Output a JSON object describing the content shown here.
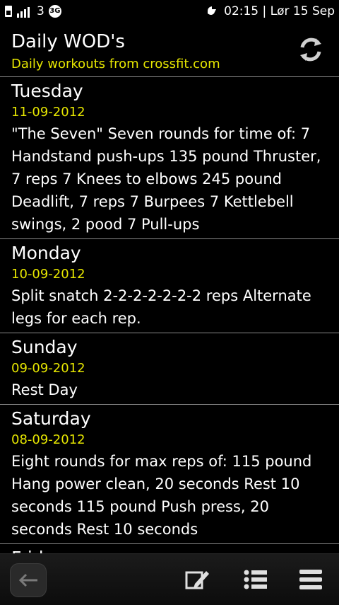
{
  "status": {
    "signal_label": "3",
    "network_badge": "3G",
    "time_date": "02:15 | Lør 15 Sep"
  },
  "header": {
    "title": "Daily WOD's",
    "subtitle": "Daily workouts from crossfit.com"
  },
  "entries": [
    {
      "day": "Tuesday",
      "date": "11-09-2012",
      "description": "\"The Seven\" Seven rounds for time of: 7 Handstand push-ups 135 pound Thruster, 7 reps 7 Knees to elbows 245 pound Deadlift, 7 reps 7 Burpees 7 Kettlebell swings, 2 pood 7 Pull-ups"
    },
    {
      "day": "Monday",
      "date": "10-09-2012",
      "description": "Split snatch 2-2-2-2-2-2-2 reps Alternate legs for each rep."
    },
    {
      "day": "Sunday",
      "date": "09-09-2012",
      "description": "Rest Day"
    },
    {
      "day": "Saturday",
      "date": "08-09-2012",
      "description": "Eight rounds for max reps of: 115 pound Hang power clean, 20 seconds Rest 10 seconds 115 pound Push press, 20 seconds Rest 10 seconds"
    },
    {
      "day": "Friday",
      "date": "",
      "description": ""
    }
  ],
  "icons": {
    "refresh": "refresh-icon",
    "back": "back-arrow-icon",
    "edit": "edit-icon",
    "list": "list-icon",
    "menu": "menu-icon"
  }
}
